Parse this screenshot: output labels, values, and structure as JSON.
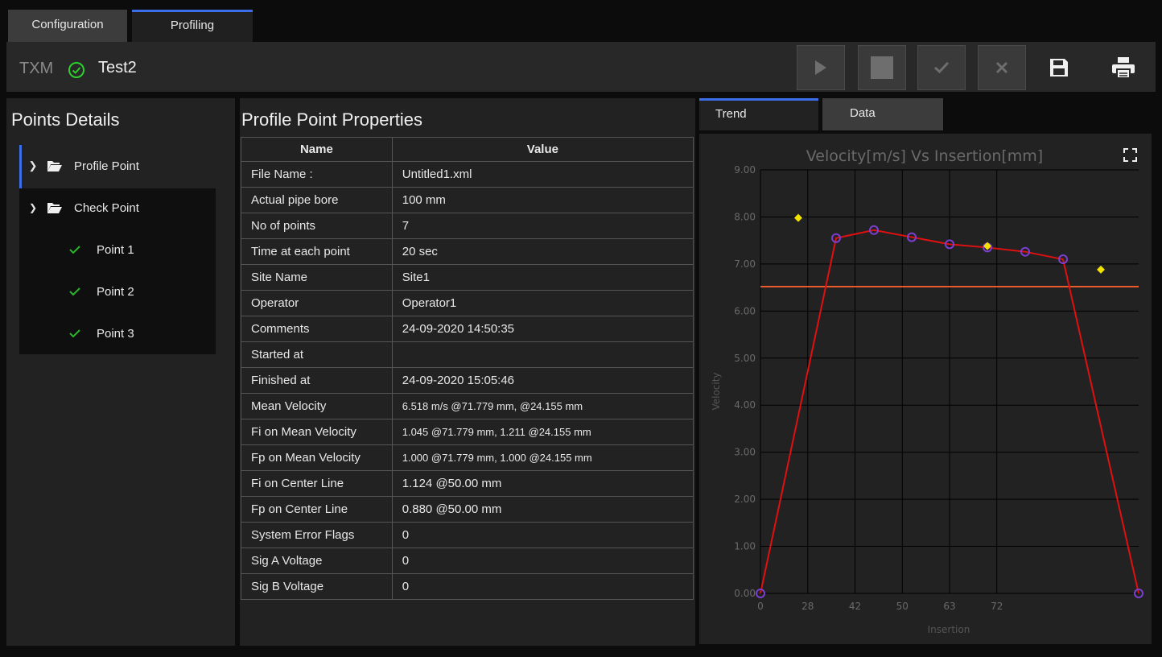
{
  "top_tabs": [
    {
      "label": "Configuration",
      "active": false
    },
    {
      "label": "Profiling",
      "active": true
    }
  ],
  "header": {
    "prefix": "TXM",
    "status_icon": "check-circle-icon",
    "title": "Test2"
  },
  "toolbar": {
    "buttons": [
      "play-icon",
      "stop-icon",
      "check-icon",
      "close-icon",
      "save-icon",
      "print-icon"
    ]
  },
  "points_panel": {
    "title": "Points Details",
    "tree": [
      {
        "label": "Profile Point",
        "expanded": false,
        "children": []
      },
      {
        "label": "Check Point",
        "expanded": true,
        "children": [
          "Point 1",
          "Point 2",
          "Point 3"
        ]
      }
    ]
  },
  "properties": {
    "title": "Profile Point Properties",
    "headers": [
      "Name",
      "Value"
    ],
    "rows": [
      [
        "File Name :",
        "Untitled1.xml"
      ],
      [
        "Actual pipe bore",
        "100 mm"
      ],
      [
        "No of points",
        "7"
      ],
      [
        "Time at each point",
        "20 sec"
      ],
      [
        "Site Name",
        "Site1"
      ],
      [
        "Operator",
        "Operator1"
      ],
      [
        "Comments",
        "24-09-2020 14:50:35"
      ],
      [
        "Started at",
        ""
      ],
      [
        "Finished at",
        "24-09-2020 15:05:46"
      ],
      [
        "Mean Velocity",
        "6.518 m/s @71.779 mm, @24.155 mm"
      ],
      [
        "Fi on Mean Velocity",
        "1.045 @71.779 mm, 1.211 @24.155 mm"
      ],
      [
        "Fp on Mean Velocity",
        "1.000 @71.779 mm, 1.000 @24.155 mm"
      ],
      [
        "Fi on Center Line",
        "1.124 @50.00 mm"
      ],
      [
        "Fp on Center Line",
        "0.880 @50.00 mm"
      ],
      [
        "System Error Flags",
        "0"
      ],
      [
        "Sig A Voltage",
        "0"
      ],
      [
        "Sig B Voltage",
        "0"
      ]
    ]
  },
  "right_tabs": [
    {
      "label": "Trend",
      "active": true
    },
    {
      "label": "Data",
      "active": false
    }
  ],
  "chart_data": {
    "type": "line",
    "title": "Velocity[m/s] Vs Insertion[mm]",
    "xlabel": "Insertion",
    "ylabel": "Velocity",
    "xlim": [
      0,
      80
    ],
    "ylim": [
      0,
      9
    ],
    "x_tick_labels": [
      "0",
      "28",
      "42",
      "50",
      "63",
      "72"
    ],
    "y_tick_labels": [
      "0.00",
      "1.00",
      "2.00",
      "3.00",
      "4.00",
      "5.00",
      "6.00",
      "7.00",
      "8.00",
      "9.00"
    ],
    "grid": true,
    "series": [
      {
        "values_x": [
          0,
          16,
          24,
          32,
          40,
          48,
          56,
          64,
          80
        ],
        "values_y": [
          0.0,
          7.55,
          7.72,
          7.57,
          7.42,
          7.35,
          7.26,
          7.1,
          0.0
        ],
        "color": "#e01010",
        "marker_color": "#7a3fd0"
      },
      {
        "points_x": [
          8,
          48,
          72
        ],
        "points_y": [
          7.98,
          7.38,
          6.88
        ],
        "color": "#f2e200",
        "marker": "diamond"
      }
    ],
    "hline": {
      "y": 6.52,
      "color": "#e85a2a"
    },
    "colors": {
      "bg": "#222222",
      "grid": "#000000",
      "text": "#6a6a6a"
    }
  }
}
